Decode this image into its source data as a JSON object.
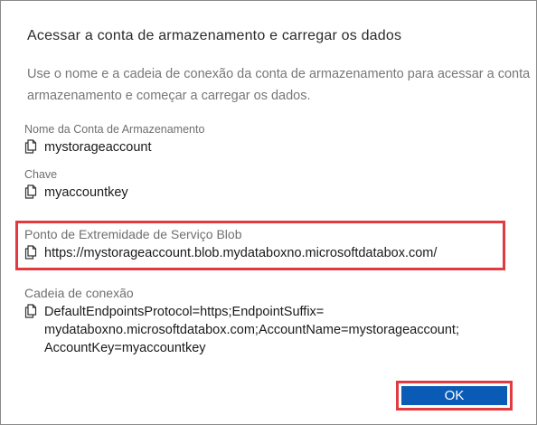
{
  "dialog": {
    "title": "Acessar a conta de armazenamento e carregar os dados",
    "description_line1": "Use o nome e a cadeia de conexão da conta de armazenamento para acessar a conta",
    "description_line2": "armazenamento e começar a carregar os dados."
  },
  "fields": {
    "account_name": {
      "label": "Nome da Conta de Armazenamento",
      "value": "mystorageaccount"
    },
    "key": {
      "label": "Chave",
      "value": "myaccountkey"
    },
    "blob_endpoint": {
      "label": "Ponto de Extremidade de Serviço Blob",
      "value": "https://mystorageaccount.blob.mydataboxno.microsoftdatabox.com/"
    },
    "connection_string": {
      "label": "Cadeia de conexão",
      "line1": "DefaultEndpointsProtocol=https;EndpointSuffix=",
      "line2": "mydataboxno.microsoftdatabox.com;AccountName=mystorageaccount;",
      "line3": "AccountKey=myaccountkey"
    }
  },
  "buttons": {
    "ok_label": "OK"
  },
  "icons": {
    "copy": "copy-icon"
  },
  "colors": {
    "highlight": "#e23a41",
    "button": "#0a5bb5"
  }
}
